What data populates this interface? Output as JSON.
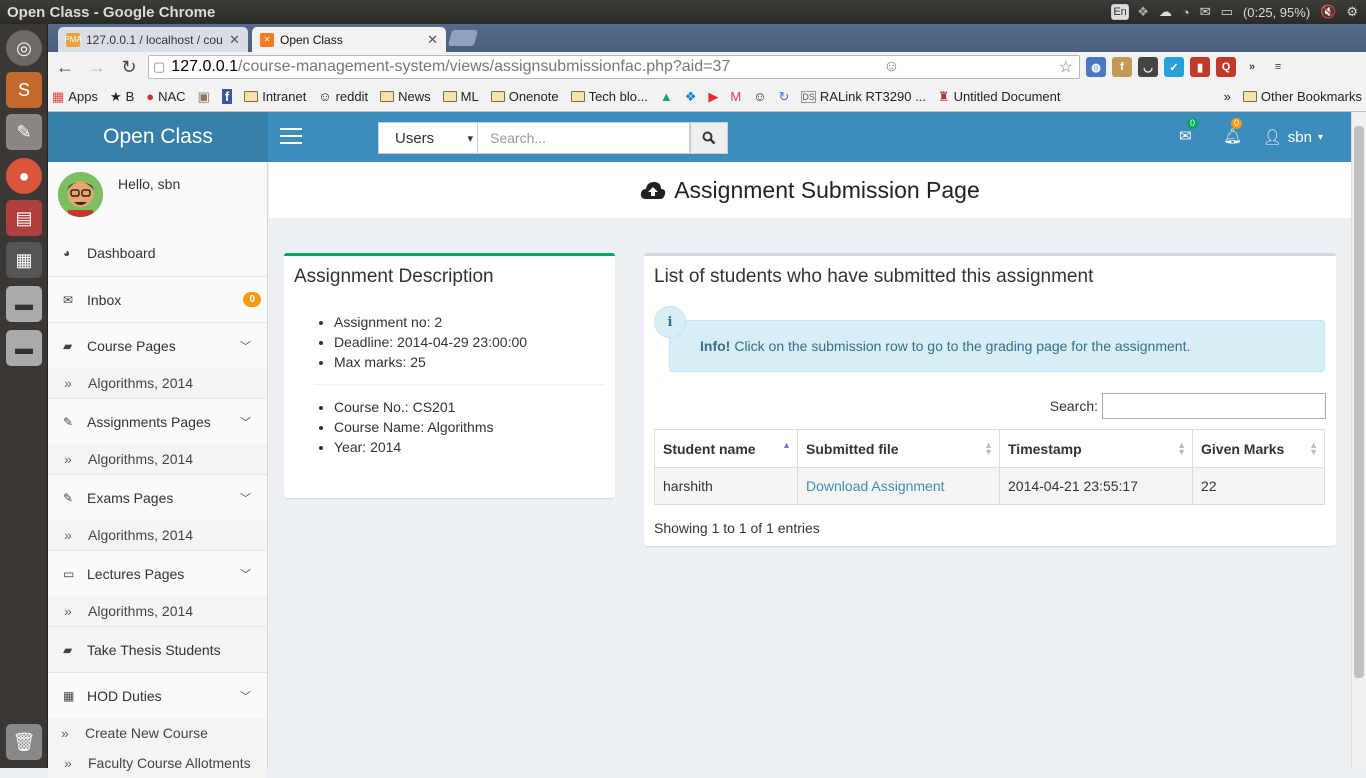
{
  "os": {
    "window_title": "Open Class - Google Chrome",
    "lang": "En",
    "battery": "(0:25, 95%)"
  },
  "browser": {
    "tabs": [
      {
        "label": "127.0.0.1 / localhost / cou"
      },
      {
        "label": "Open Class"
      }
    ],
    "url_host": "127.0.0.1",
    "url_path": "/course-management-system/views/assignsubmissionfac.php?aid=37",
    "bookmarks": [
      "Apps",
      "B",
      "NAC",
      "Intranet",
      "reddit",
      "News",
      "ML",
      "Onenote",
      "Tech blo...",
      "RALink RT3290 ...",
      "Untitled Document"
    ],
    "other_bookmarks": "Other Bookmarks",
    "overflow": "»"
  },
  "app": {
    "logo": "Open Class",
    "search_scope": "Users",
    "search_placeholder": "Search...",
    "mail_count": "0",
    "notif_count": "0",
    "username": "sbn"
  },
  "sidebar": {
    "hello": "Hello, sbn",
    "dashboard": "Dashboard",
    "inbox": "Inbox",
    "inbox_count": "0",
    "course_pages": "Course Pages",
    "course_sub": "Algorithms, 2014",
    "assign_pages": "Assignments Pages",
    "assign_sub": "Algorithms, 2014",
    "exam_pages": "Exams Pages",
    "exam_sub": "Algorithms, 2014",
    "lecture_pages": "Lectures Pages",
    "lecture_sub": "Algorithms, 2014",
    "thesis": "Take Thesis Students",
    "hod": "HOD Duties",
    "hod_sub1": "Create New Course",
    "hod_sub2": "Faculty Course Allotments"
  },
  "page": {
    "title": "Assignment Submission Page"
  },
  "description": {
    "title": "Assignment Description",
    "items1": [
      "Assignment no: 2",
      "Deadline: 2014-04-29 23:00:00",
      "Max marks: 25"
    ],
    "items2": [
      "Course No.: CS201",
      "Course Name: Algorithms",
      "Year: 2014"
    ]
  },
  "submissions": {
    "title": "List of students who have submitted this assignment",
    "info_bold": "Info!",
    "info_text": "Click on the submission row to go to the grading page for the assignment.",
    "search_label": "Search:",
    "columns": [
      "Student name",
      "Submitted file",
      "Timestamp",
      "Given Marks"
    ],
    "rows": [
      [
        "harshith",
        "Download Assignment",
        "2014-04-21 23:55:17",
        "22"
      ]
    ],
    "showing": "Showing 1 to 1 of 1 entries"
  },
  "colors": {
    "navbar": "#3c8dbc",
    "logo_bg": "#367fa9",
    "badge": "#f39c12",
    "info_bg": "#d9edf7",
    "desc_border": "#00a65a"
  }
}
